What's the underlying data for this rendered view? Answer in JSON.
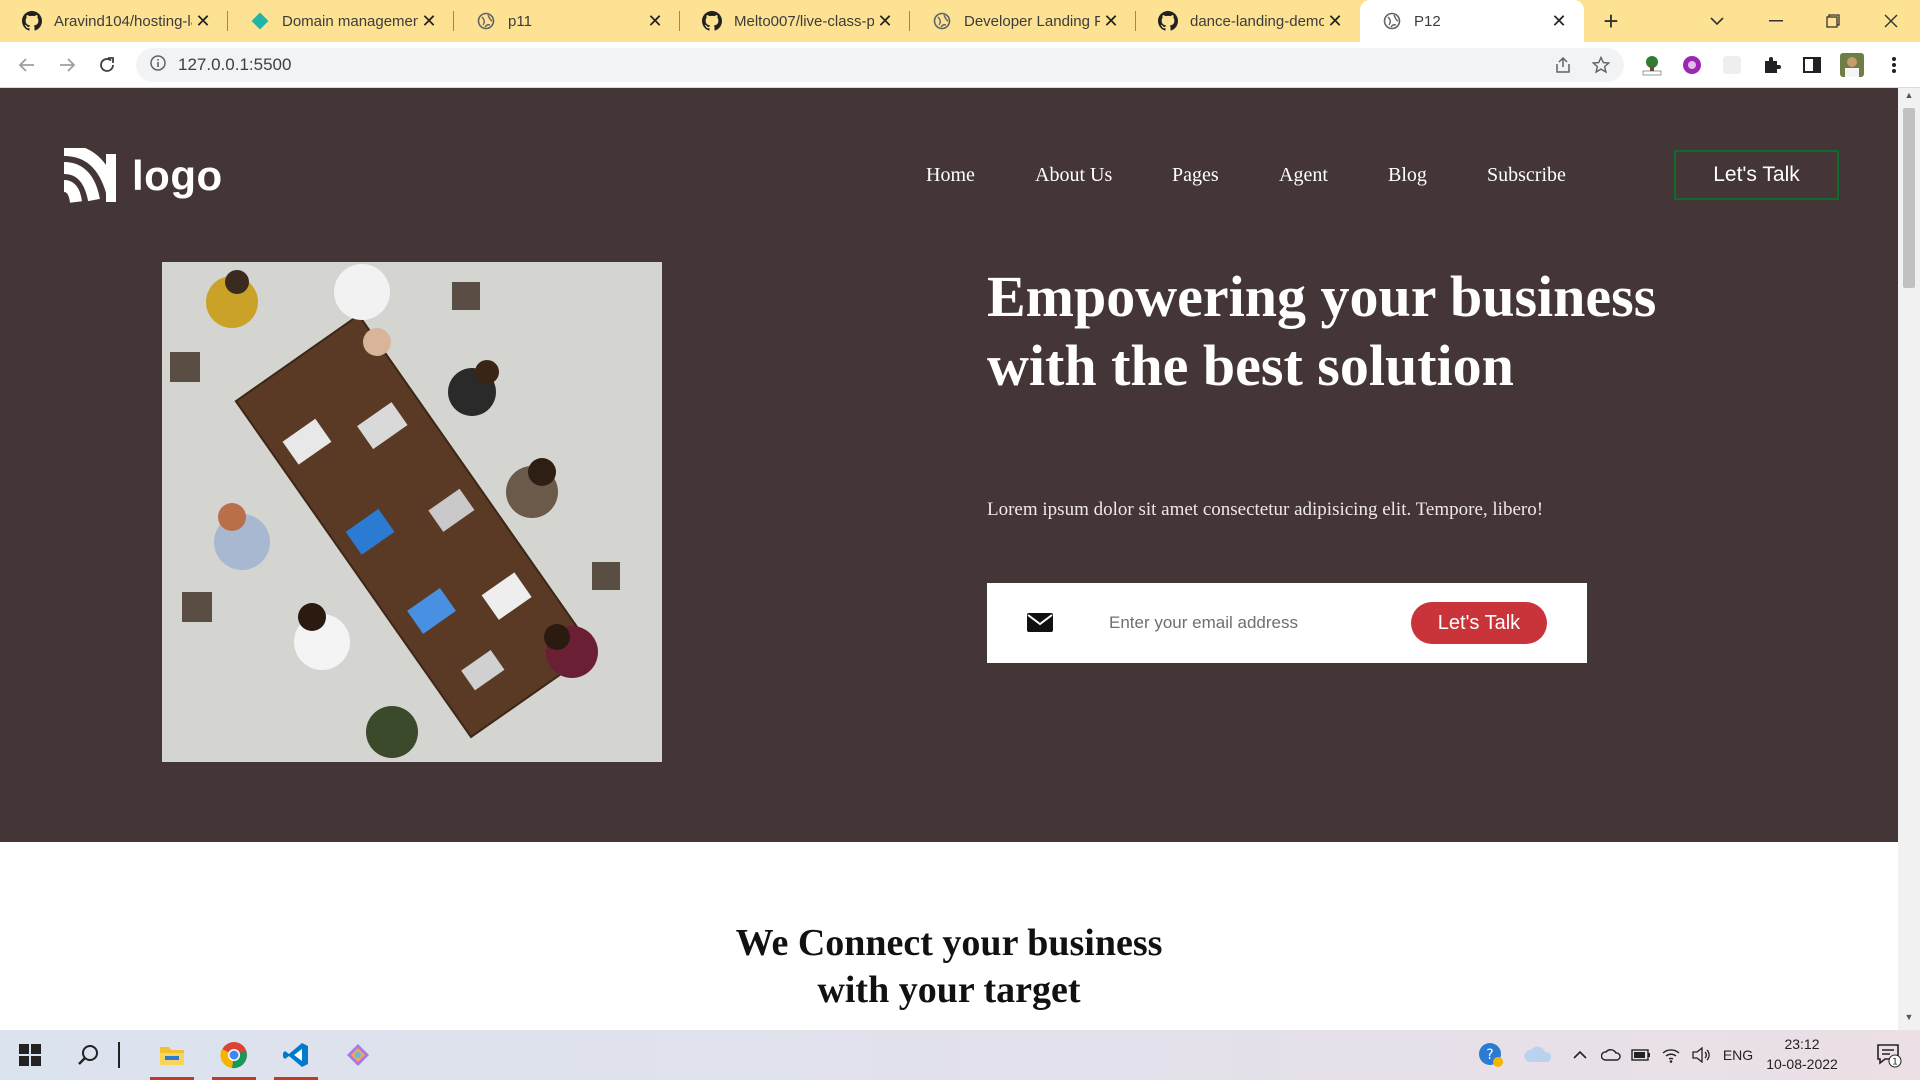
{
  "browser": {
    "tabs": [
      {
        "title": "Aravind104/hosting-la",
        "icon": "github-icon"
      },
      {
        "title": "Domain management",
        "icon": "netlify-icon"
      },
      {
        "title": "p11",
        "icon": "globe-icon"
      },
      {
        "title": "Melto007/live-class-p",
        "icon": "github-icon"
      },
      {
        "title": "Developer Landing Pa",
        "icon": "globe-icon"
      },
      {
        "title": "dance-landing-demo",
        "icon": "github-icon"
      },
      {
        "title": "P12",
        "icon": "globe-icon",
        "active": true
      }
    ],
    "url": "127.0.0.1:5500"
  },
  "page": {
    "logo_text": "logo",
    "nav": [
      "Home",
      "About Us",
      "Pages",
      "Agent",
      "Blog",
      "Subscribe"
    ],
    "cta_top": "Let's Talk",
    "headline": "Empowering your business with the best solution",
    "subtext": "Lorem ipsum dolor sit amet consectetur adipisicing elit. Tempore, libero!",
    "email_placeholder": "Enter your email address",
    "cta_email": "Let's Talk",
    "section2_title_line1": "We Connect your business",
    "section2_title_line2": "with your target",
    "colors": {
      "hero_bg": "#443636",
      "cta_red": "#c9343b",
      "cta_border": "#0e6b2d"
    }
  },
  "taskbar": {
    "language": "ENG",
    "time": "23:12",
    "date": "10-08-2022",
    "notification_count": "1"
  }
}
